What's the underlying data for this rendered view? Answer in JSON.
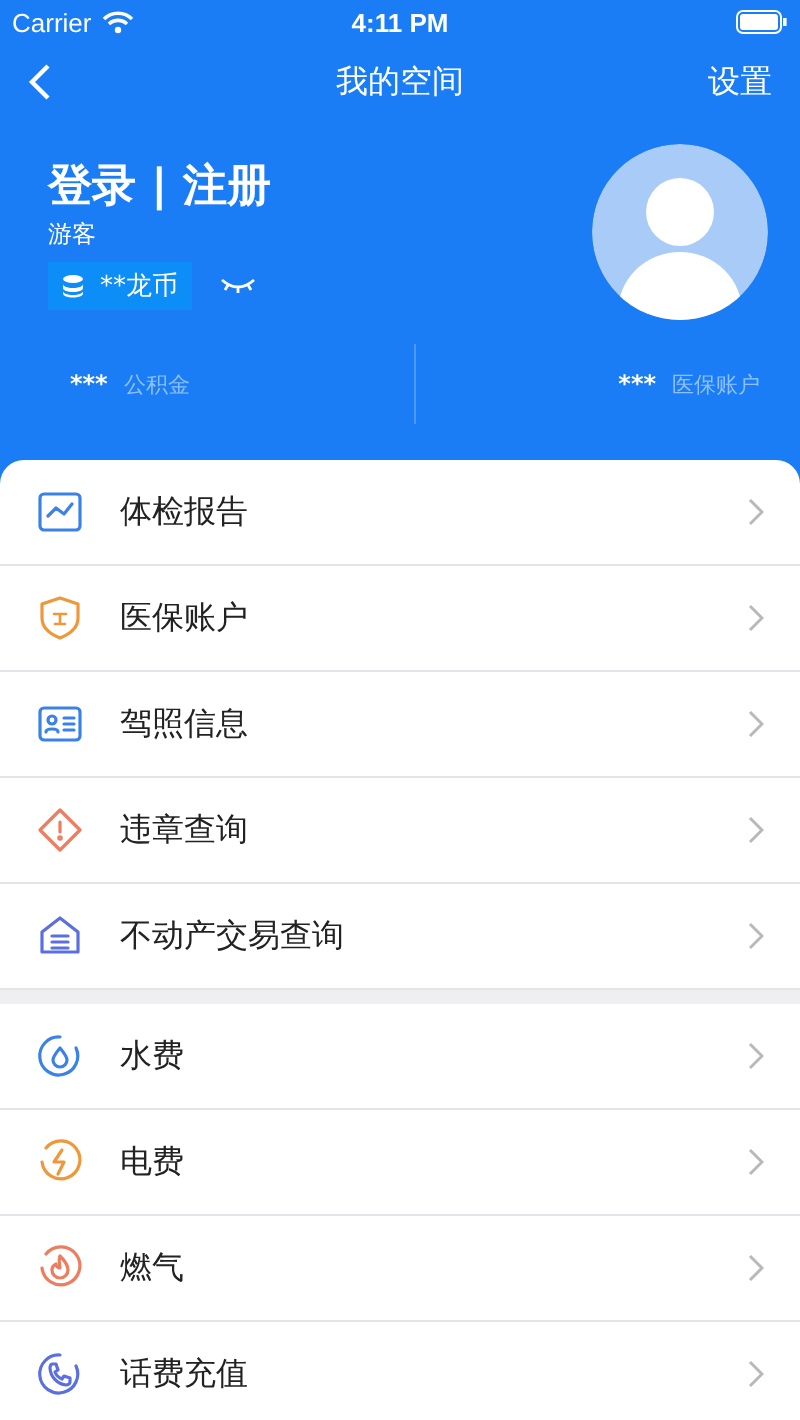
{
  "status_bar": {
    "carrier": "Carrier",
    "time": "4:11 PM"
  },
  "nav": {
    "title": "我的空间",
    "action": "设置"
  },
  "profile": {
    "title": "登录 | 注册",
    "subtitle": "游客",
    "coins": "**龙币",
    "hidden": true
  },
  "stats": [
    {
      "value": "***",
      "label": "公积金"
    },
    {
      "value": "***",
      "label": "医保账户"
    }
  ],
  "sections": [
    {
      "items": [
        {
          "kind": "chart",
          "label": "体检报告"
        },
        {
          "kind": "shield",
          "label": "医保账户"
        },
        {
          "kind": "card",
          "label": "驾照信息"
        },
        {
          "kind": "warning",
          "label": "违章查询"
        },
        {
          "kind": "house",
          "label": "不动产交易查询"
        }
      ]
    },
    {
      "items": [
        {
          "kind": "water",
          "label": "水费"
        },
        {
          "kind": "bolt",
          "label": "电费"
        },
        {
          "kind": "flame",
          "label": "燃气"
        },
        {
          "kind": "phone",
          "label": "话费充值"
        }
      ]
    }
  ]
}
